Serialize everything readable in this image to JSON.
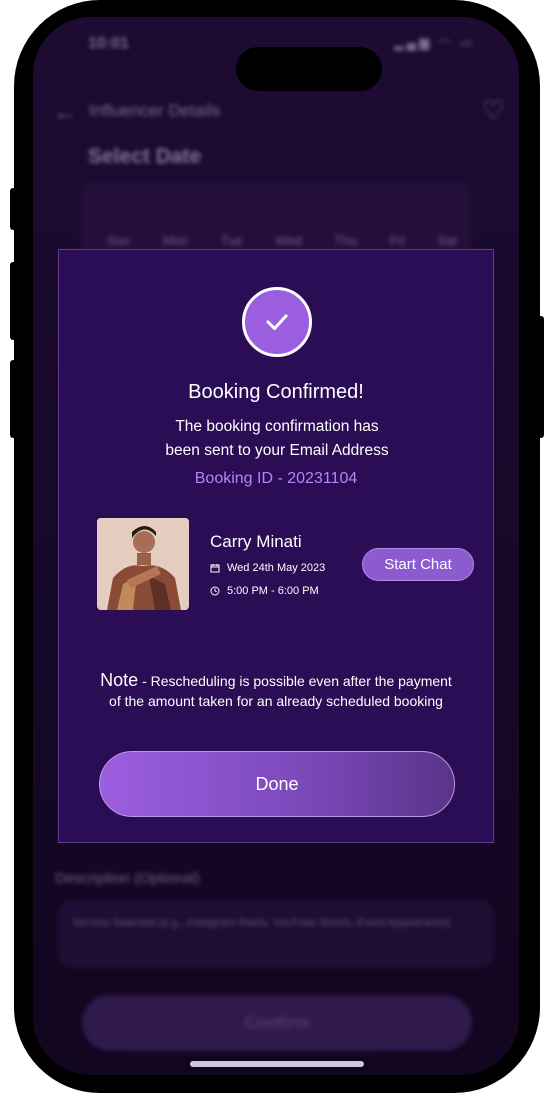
{
  "status_bar": {
    "time": "10:01",
    "icons": "▂▄▆ ◠ ▭"
  },
  "header": {
    "title": "Influencer Details"
  },
  "background": {
    "section_title": "Select Date",
    "weekdays": [
      "Sun",
      "Mon",
      "Tue",
      "Wed",
      "Thu",
      "Fri",
      "Sat"
    ],
    "description_label": "Description (Optional)",
    "description_placeholder": "Service Selected (e.g., Instagram Reels, YouTube Shorts, Event Appearance)",
    "confirm_label": "Confirm"
  },
  "modal": {
    "title": "Booking Confirmed!",
    "message_line1": "The booking confirmation has",
    "message_line2": "been sent to your Email Address",
    "booking_id": "Booking ID - 20231104",
    "influencer": {
      "name": "Carry Minati",
      "date": "Wed 24th May 2023",
      "time": "5:00 PM - 6:00 PM"
    },
    "start_chat_label": "Start Chat",
    "note_label": "Note",
    "note_text_line1": " - Rescheduling is possible even after the payment",
    "note_text_line2": "of the amount taken for an already scheduled booking",
    "done_label": "Done"
  },
  "colors": {
    "accent": "#9c5ee0",
    "booking_id": "#b785f2",
    "modal_bg": "#2a0d55"
  }
}
